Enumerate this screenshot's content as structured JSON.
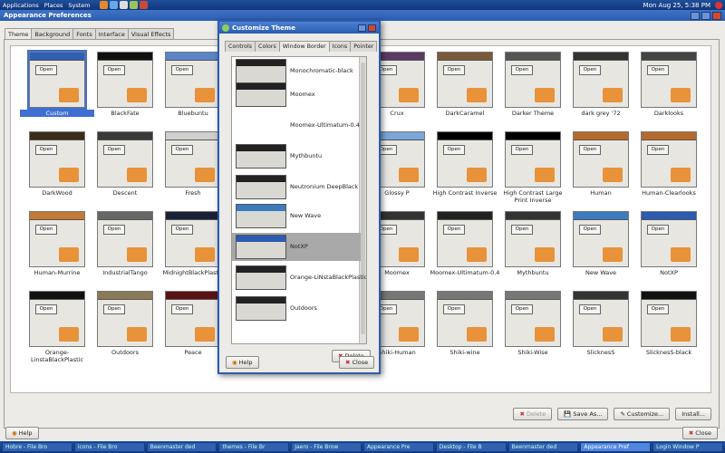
{
  "topbar": {
    "menus": [
      "Applications",
      "Places",
      "System"
    ],
    "clock": "Mon Aug 25,  5:38 PM"
  },
  "window": {
    "title": "Appearance Preferences"
  },
  "tabs": [
    {
      "label": "Theme"
    },
    {
      "label": "Background"
    },
    {
      "label": "Fonts"
    },
    {
      "label": "Interface"
    },
    {
      "label": "Visual Effects"
    }
  ],
  "themes": [
    {
      "name": "Custom",
      "top": "#2f5fb5"
    },
    {
      "name": "BlackFate",
      "top": "#111"
    },
    {
      "name": "Bluebuntu",
      "top": "#5a86c9"
    },
    {
      "name": "Crux",
      "top": "#5b3a63"
    },
    {
      "name": "DarkCaramel",
      "top": "#7a5a3a"
    },
    {
      "name": "Darker Theme",
      "top": "#555"
    },
    {
      "name": "dark grey  '72",
      "top": "#333"
    },
    {
      "name": "Darklooks",
      "top": "#444"
    },
    {
      "name": "DarkWood",
      "top": "#3b2b1b"
    },
    {
      "name": "Descent",
      "top": "#3a3a3a"
    },
    {
      "name": "Fresh",
      "top": "#cfcfcf"
    },
    {
      "name": "Glossy P",
      "top": "#7aa6d8"
    },
    {
      "name": "High Contrast Inverse",
      "top": "#000"
    },
    {
      "name": "High Contrast Large Print Inverse",
      "top": "#000"
    },
    {
      "name": "Human",
      "top": "#b56a2b"
    },
    {
      "name": "Human-Clearlooks",
      "top": "#b56a2b"
    },
    {
      "name": "Human-Murrine",
      "top": "#c47a35"
    },
    {
      "name": "IndustrialTango",
      "top": "#666"
    },
    {
      "name": "MidnightBlackPlastic",
      "top": "#1c2235"
    },
    {
      "name": "Moomex",
      "top": "#333"
    },
    {
      "name": "Moomex-Ultimatum-0.4",
      "top": "#222"
    },
    {
      "name": "Mythbuntu",
      "top": "#333"
    },
    {
      "name": "New Wave",
      "top": "#3b7bbf"
    },
    {
      "name": "NotXP",
      "top": "#2b5cb0"
    },
    {
      "name": "Orange-\nLinstaBlackPlastic",
      "top": "#111"
    },
    {
      "name": "Outdoors",
      "top": "#8a7a55"
    },
    {
      "name": "Peace",
      "top": "#5a1212"
    },
    {
      "name": "Shiki-Human",
      "top": "#777"
    },
    {
      "name": "Shiki-wine",
      "top": "#777"
    },
    {
      "name": "Shiki-Wise",
      "top": "#777"
    },
    {
      "name": "SlicknesS",
      "top": "#333"
    },
    {
      "name": "SlicknesS-black",
      "top": "#111"
    }
  ],
  "buttons": {
    "delete": "Delete",
    "save_as": "Save As...",
    "customize": "Customize...",
    "install": "Install...",
    "help": "Help",
    "close": "Close"
  },
  "dialog": {
    "title": "Customize Theme",
    "tabs": [
      "Controls",
      "Colors",
      "Window Border",
      "Icons",
      "Pointer"
    ],
    "active_tab": "Window Border",
    "items": [
      "Monochromatic-black",
      "Moomex",
      "Moomex-Ultimatum-0.4",
      "Mythbuntu",
      "Neutronium DeepBlack",
      "New Wave",
      "NotXP",
      "Orange-LiNstaBlackPlastic",
      "Outdoors"
    ],
    "selected": "NotXP",
    "delete": "Delete",
    "help": "Help",
    "close": "Close"
  },
  "taskbar": [
    "Hobre - File Bro",
    "icons - File Bro",
    "Beenmaster ded",
    "themes - File Br",
    "Jaero - File Brow",
    "Appearance Pre",
    "Desktop - File B",
    "Beenmaster ded",
    "Appearance Pref",
    "Login Window P"
  ],
  "taskbar_active": 8
}
